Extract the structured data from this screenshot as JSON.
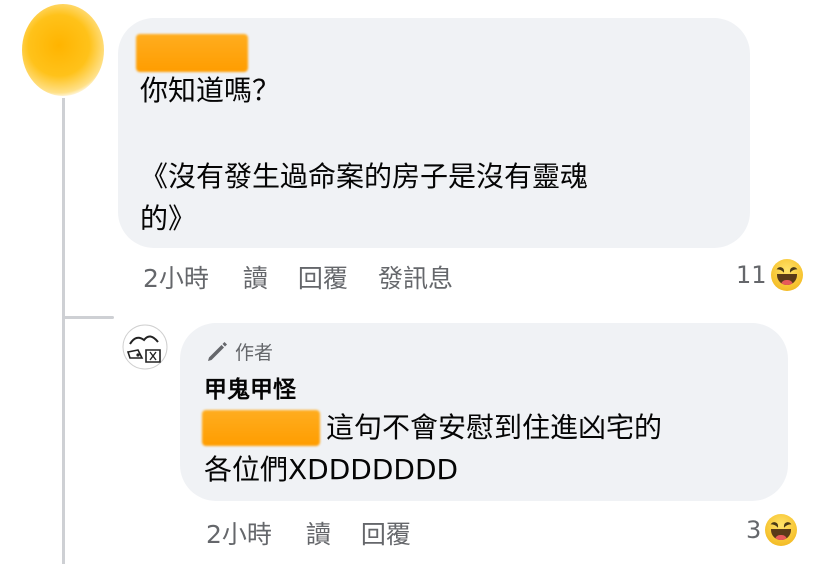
{
  "comment": {
    "text_line1": "你知道嗎？",
    "text_line2": "《沒有發生過命案的房子是沒有靈魂",
    "text_line3": "的》",
    "actions": {
      "time": "2小時",
      "read": "讀",
      "reply": "回覆",
      "message": "發訊息"
    },
    "reaction": {
      "count": "11",
      "icon": "haha-icon"
    }
  },
  "reply": {
    "badge_label": "作者",
    "badge_icon": "pencil-icon",
    "author": "甲鬼甲怪",
    "text_line1": "這句不會安慰到住進凶宅的",
    "text_line2": "各位們XDDDDDDD",
    "actions": {
      "time": "2小時",
      "read": "讀",
      "reply": "回覆"
    },
    "reaction": {
      "count": "3",
      "icon": "haha-icon"
    }
  },
  "colors": {
    "bubble_bg": "#f0f2f5",
    "meta_text": "#65676b",
    "redaction": "#ff9d00"
  }
}
